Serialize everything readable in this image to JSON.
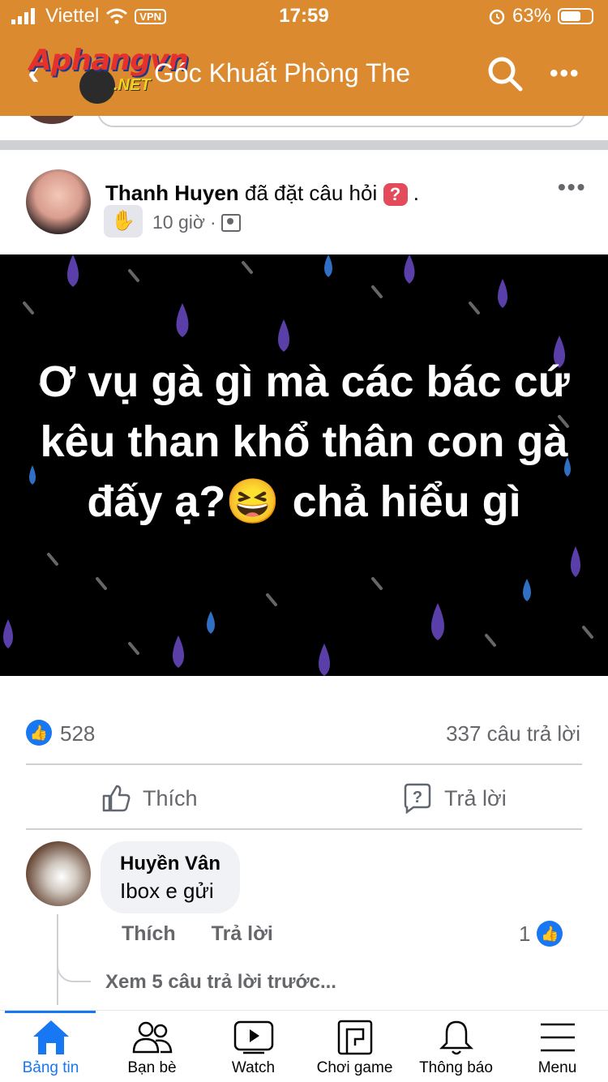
{
  "status_bar": {
    "carrier": "Viettel",
    "vpn": "VPN",
    "time": "17:59",
    "battery": "63%"
  },
  "header": {
    "logo_line1": "Aphangvn",
    "logo_line2": ".NET",
    "title": "Góc Khuất Phòng The"
  },
  "post": {
    "author": "Thanh Huyen",
    "action": "đã đặt câu hỏi",
    "question_mark": "?",
    "period": ".",
    "time": "10 giờ",
    "dot": "·",
    "text": "Ơ vụ gà gì mà các bác cứ kêu than khổ thân con gà  đấy ạ?😆 chả hiểu gì",
    "background_color": "#000000"
  },
  "stats": {
    "likes": "528",
    "replies": "337 câu trả lời"
  },
  "actions": {
    "like": "Thích",
    "reply": "Trả lời"
  },
  "comment": {
    "name": "Huyền Vân",
    "text": "Ibox e gửi",
    "like": "Thích",
    "reply": "Trả lời",
    "likes": "1",
    "view_previous": "Xem 5 câu trả lời trước..."
  },
  "tabbar": {
    "tabs": [
      {
        "label": "Bảng tin",
        "icon": "home-icon",
        "active": true
      },
      {
        "label": "Bạn bè",
        "icon": "friends-icon"
      },
      {
        "label": "Watch",
        "icon": "watch-icon"
      },
      {
        "label": "Chơi game",
        "icon": "gaming-icon"
      },
      {
        "label": "Thông báo",
        "icon": "bell-icon"
      },
      {
        "label": "Menu",
        "icon": "menu-icon"
      }
    ]
  },
  "colors": {
    "header": "#dc8a2f",
    "accent": "#1877f2",
    "question": "#e34a5a"
  }
}
